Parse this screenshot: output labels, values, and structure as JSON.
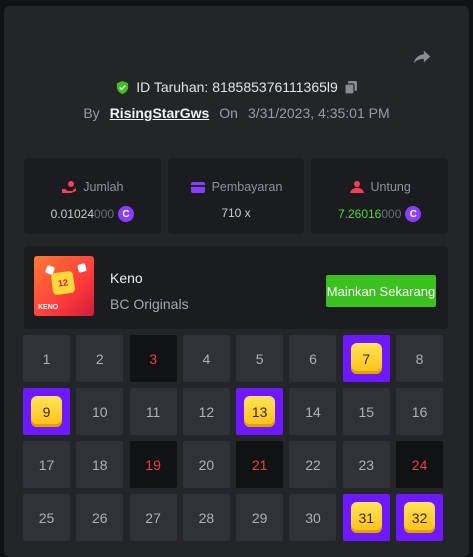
{
  "bet": {
    "id_label": "ID Taruhan: 818585376111365l9",
    "by_label": "By",
    "user": "RisingStarGws",
    "on_label": "On",
    "datetime": "3/31/2023, 4:35:01 PM"
  },
  "stats": [
    {
      "label": "Jumlah",
      "value_main": "0.01024",
      "value_dim": "000",
      "currency_icon": "coin-icon"
    },
    {
      "label": "Pembayaran",
      "value_main": "710 x",
      "value_dim": ""
    },
    {
      "label": "Untung",
      "value_main": "7.26016",
      "value_dim": "000",
      "currency_icon": "coin-icon"
    }
  ],
  "game": {
    "thumb_number": "12",
    "thumb_label": "KENO",
    "name": "Keno",
    "provider": "BC Originals",
    "play_button": "Mainkan Sekarang"
  },
  "currency_glyph": "C",
  "colors": {
    "hit": "#6d18ff",
    "miss_text": "#f03b3b",
    "play": "#3bc11e",
    "profit": "#4fd83a"
  },
  "grid": [
    {
      "n": "1",
      "s": "normal"
    },
    {
      "n": "2",
      "s": "normal"
    },
    {
      "n": "3",
      "s": "miss"
    },
    {
      "n": "4",
      "s": "normal"
    },
    {
      "n": "5",
      "s": "normal"
    },
    {
      "n": "6",
      "s": "normal"
    },
    {
      "n": "7",
      "s": "hit"
    },
    {
      "n": "8",
      "s": "normal"
    },
    {
      "n": "9",
      "s": "hit"
    },
    {
      "n": "10",
      "s": "normal"
    },
    {
      "n": "11",
      "s": "normal"
    },
    {
      "n": "12",
      "s": "normal"
    },
    {
      "n": "13",
      "s": "hit"
    },
    {
      "n": "14",
      "s": "normal"
    },
    {
      "n": "15",
      "s": "normal"
    },
    {
      "n": "16",
      "s": "normal"
    },
    {
      "n": "17",
      "s": "normal"
    },
    {
      "n": "18",
      "s": "normal"
    },
    {
      "n": "19",
      "s": "miss"
    },
    {
      "n": "20",
      "s": "normal"
    },
    {
      "n": "21",
      "s": "miss"
    },
    {
      "n": "22",
      "s": "normal"
    },
    {
      "n": "23",
      "s": "normal"
    },
    {
      "n": "24",
      "s": "miss"
    },
    {
      "n": "25",
      "s": "normal"
    },
    {
      "n": "26",
      "s": "normal"
    },
    {
      "n": "27",
      "s": "normal"
    },
    {
      "n": "28",
      "s": "normal"
    },
    {
      "n": "29",
      "s": "normal"
    },
    {
      "n": "30",
      "s": "normal"
    },
    {
      "n": "31",
      "s": "hit"
    },
    {
      "n": "32",
      "s": "hit"
    }
  ]
}
